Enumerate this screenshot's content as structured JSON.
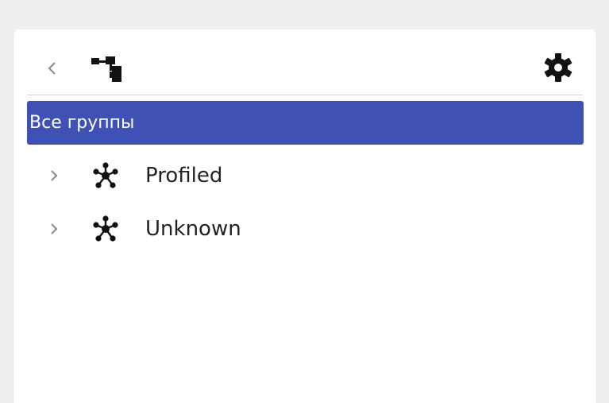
{
  "toolbar": {
    "back_icon": "chevron-left-icon",
    "tree_icon": "tree-structure-icon",
    "settings_icon": "gear-icon"
  },
  "tree": {
    "root_label": "Все группы",
    "items": [
      {
        "label": "Profiled",
        "icon": "network-cluster-icon",
        "expand_icon": "chevron-right-icon"
      },
      {
        "label": "Unknown",
        "icon": "network-cluster-icon",
        "expand_icon": "chevron-right-icon"
      }
    ]
  },
  "colors": {
    "page_background": "#efefef",
    "panel_background": "#ffffff",
    "selected_background": "#3f51b5",
    "selected_text": "#ffffff",
    "icon_color": "#111111",
    "muted_icon_color": "#8a8a8a"
  }
}
